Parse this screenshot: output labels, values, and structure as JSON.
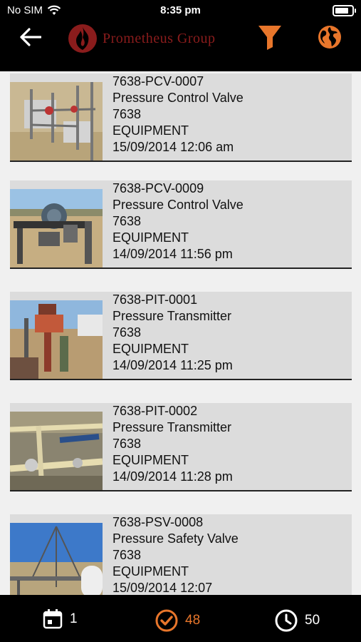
{
  "status_bar": {
    "carrier": "No SIM",
    "time": "8:35 pm"
  },
  "header": {
    "logo_text": "Prometheus Group",
    "back_icon": "back-arrow-icon",
    "filter_icon": "filter-icon",
    "globe_icon": "globe-icon"
  },
  "colors": {
    "accent": "#e8762b",
    "logo_red": "#8a1c1c",
    "bar_background": "#000000",
    "card_background": "#dcdcdc"
  },
  "items": [
    {
      "tag": "7638-PCV-0007",
      "description": "Pressure Control Valve",
      "plant": "7638",
      "type": "EQUIPMENT",
      "date": "15/09/2014 12:06 am"
    },
    {
      "tag": "7638-PCV-0009",
      "description": "Pressure Control Valve",
      "plant": "7638",
      "type": "EQUIPMENT",
      "date": "14/09/2014 11:56 pm"
    },
    {
      "tag": "7638-PIT-0001",
      "description": "Pressure Transmitter",
      "plant": "7638",
      "type": "EQUIPMENT",
      "date": "14/09/2014 11:25 pm"
    },
    {
      "tag": "7638-PIT-0002",
      "description": "Pressure Transmitter",
      "plant": "7638",
      "type": "EQUIPMENT",
      "date": "14/09/2014 11:28 pm"
    },
    {
      "tag": "7638-PSV-0008",
      "description": "Pressure Safety Valve",
      "plant": "7638",
      "type": "EQUIPMENT",
      "date": "15/09/2014 12:07"
    }
  ],
  "tabs": [
    {
      "icon": "calendar-icon",
      "count": "1"
    },
    {
      "icon": "check-circle-icon",
      "count": "48"
    },
    {
      "icon": "clock-icon",
      "count": "50"
    }
  ]
}
